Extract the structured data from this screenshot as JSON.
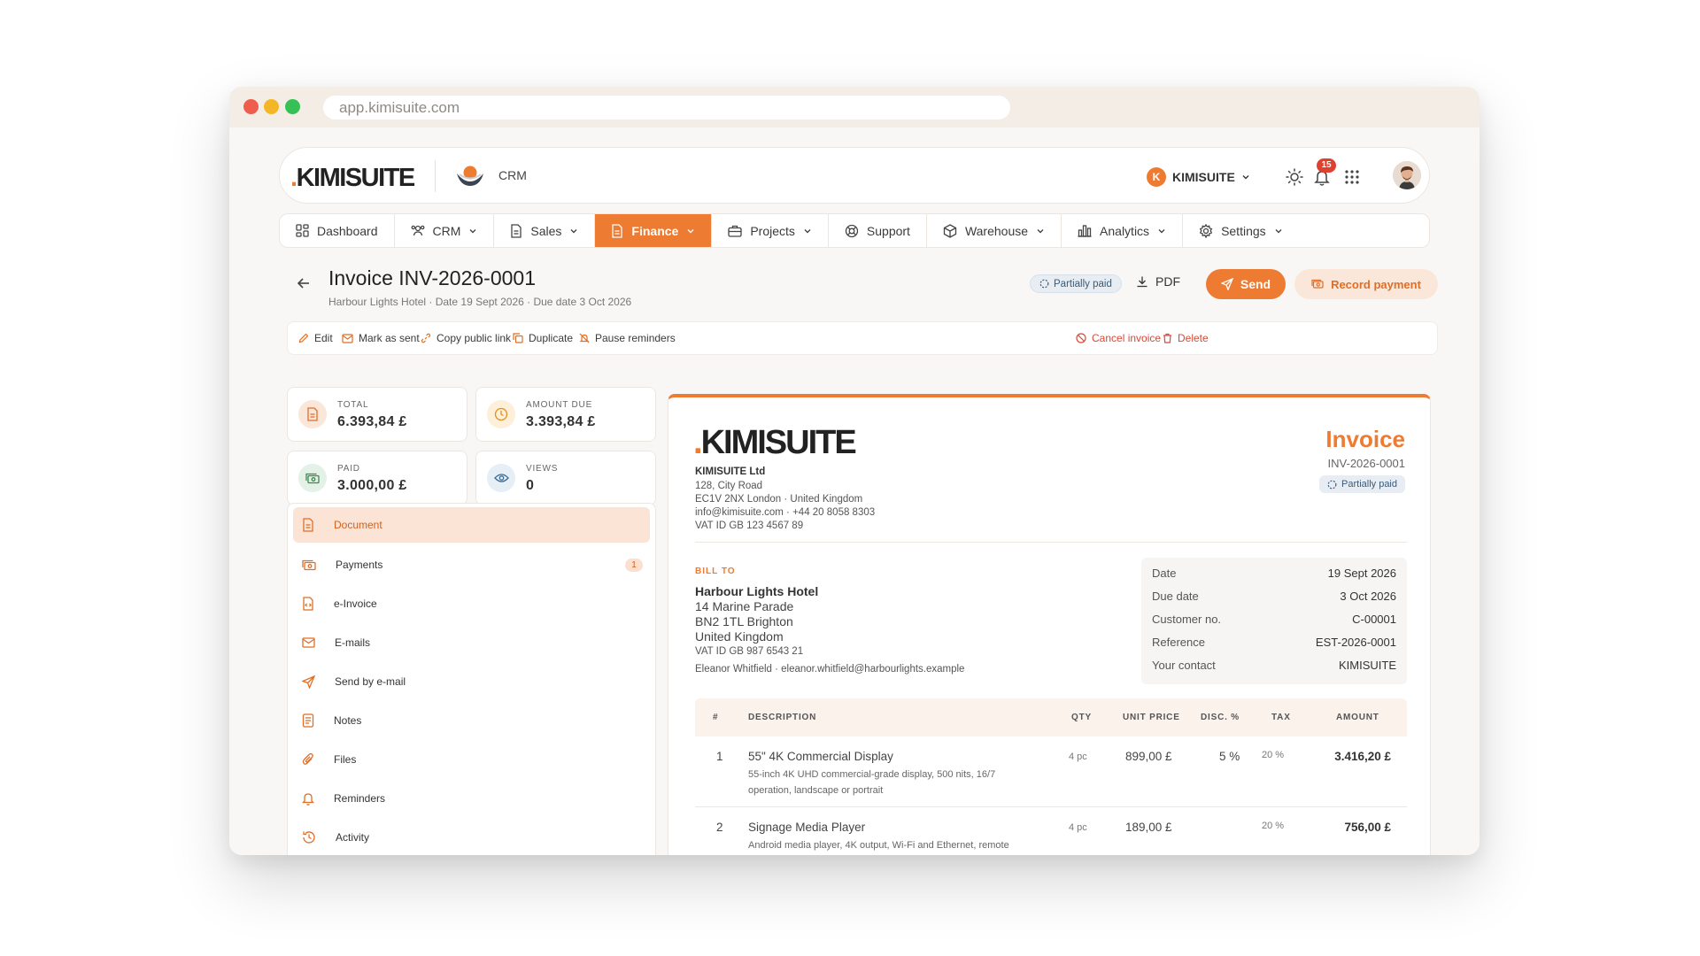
{
  "browser": {
    "url": "app.kimisuite.com"
  },
  "header": {
    "logo": {
      "dot": ".",
      "text": "KIMISUITE"
    },
    "module_label": "CRM",
    "tenant": {
      "initial": "K",
      "name": "KIMISUITE"
    },
    "notification_count": "15"
  },
  "nav": {
    "items": [
      {
        "label": "Dashboard"
      },
      {
        "label": "CRM"
      },
      {
        "label": "Sales"
      },
      {
        "label": "Finance"
      },
      {
        "label": "Projects"
      },
      {
        "label": "Support"
      },
      {
        "label": "Warehouse"
      },
      {
        "label": "Analytics"
      },
      {
        "label": "Settings"
      }
    ],
    "active": "Finance"
  },
  "invoice_header": {
    "title": "Invoice INV-2026-0001",
    "subtitle": "Harbour Lights Hotel · Date 19 Sept 2026 · Due date 3 Oct 2026",
    "status": "Partially paid",
    "pdf_label": "PDF",
    "send_label": "Send",
    "record_payment_label": "Record payment"
  },
  "actions": {
    "edit": "Edit",
    "mark_as_sent": "Mark as sent",
    "copy_public_link": "Copy public link",
    "duplicate": "Duplicate",
    "pause_reminders": "Pause reminders",
    "cancel_invoice": "Cancel invoice",
    "delete": "Delete"
  },
  "stats": {
    "total": {
      "label": "TOTAL",
      "value": "6.393,84 £"
    },
    "amount_due": {
      "label": "AMOUNT DUE",
      "value": "3.393,84 £"
    },
    "paid": {
      "label": "PAID",
      "value": "3.000,00 £"
    },
    "views": {
      "label": "VIEWS",
      "value": "0"
    }
  },
  "sidebar": {
    "items": [
      {
        "label": "Document"
      },
      {
        "label": "Payments",
        "badge": "1"
      },
      {
        "label": "e-Invoice"
      },
      {
        "label": "E-mails"
      },
      {
        "label": "Send by e-mail"
      },
      {
        "label": "Notes"
      },
      {
        "label": "Files"
      },
      {
        "label": "Reminders"
      },
      {
        "label": "Activity"
      }
    ],
    "active": "Document"
  },
  "document": {
    "logo": {
      "dot": ".",
      "text": "KIMISUITE"
    },
    "company": {
      "name": "KIMISUITE Ltd",
      "address1": "128, City Road",
      "address2": "EC1V 2NX London · United Kingdom",
      "contact": "info@kimisuite.com · +44 20 8058 8303",
      "vat": "VAT ID GB 123 4567 89"
    },
    "heading": "Invoice",
    "number": "INV-2026-0001",
    "status": "Partially paid",
    "bill_to": {
      "label": "BILL TO",
      "name": "Harbour Lights Hotel",
      "address1": "14 Marine Parade",
      "address2": "BN2 1TL Brighton",
      "country": "United Kingdom",
      "vat": "VAT ID GB 987 6543 21",
      "contact": "Eleanor Whitfield · eleanor.whitfield@harbourlights.example"
    },
    "meta": [
      {
        "key": "Date",
        "value": "19 Sept 2026"
      },
      {
        "key": "Due date",
        "value": "3 Oct 2026"
      },
      {
        "key": "Customer no.",
        "value": "C-00001"
      },
      {
        "key": "Reference",
        "value": "EST-2026-0001"
      },
      {
        "key": "Your contact",
        "value": "KIMISUITE"
      }
    ],
    "table": {
      "headers": {
        "num": "#",
        "description": "DESCRIPTION",
        "qty": "QTY",
        "unit_price": "UNIT PRICE",
        "disc": "DISC. %",
        "tax": "TAX",
        "amount": "AMOUNT"
      },
      "rows": [
        {
          "num": "1",
          "title": "55\" 4K Commercial Display",
          "description": "55-inch 4K UHD commercial-grade display, 500 nits, 16/7 operation, landscape or portrait",
          "qty": "4 pc",
          "unit_price": "899,00 £",
          "disc": "5 %",
          "tax": "20 %",
          "amount": "3.416,20 £"
        },
        {
          "num": "2",
          "title": "Signage Media Player",
          "description": "Android media player, 4K output, Wi-Fi and Ethernet, remote",
          "qty": "4 pc",
          "unit_price": "189,00 £",
          "disc": "",
          "tax": "20 %",
          "amount": "756,00 £"
        }
      ]
    }
  },
  "colors": {
    "accent": "#ee7b32",
    "accent_soft": "#fbe4d6",
    "status_bg": "#e7edf3",
    "danger": "#d84a36"
  }
}
